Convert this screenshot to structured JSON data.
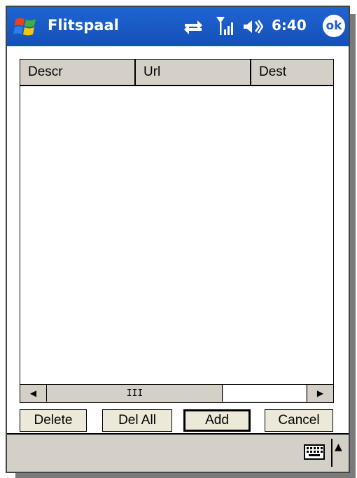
{
  "titlebar": {
    "app_title": "Flitspaal",
    "clock": "6:40",
    "ok_label": "ok",
    "start_icon": "windows-flag-icon",
    "network_icon": "data-connection-icon",
    "signal_icon": "signal-strength-icon",
    "speaker_icon": "speaker-icon"
  },
  "listview": {
    "columns": [
      "Descr",
      "Url",
      "Dest"
    ],
    "rows": [],
    "scroll_thumb_label": "III"
  },
  "buttons": {
    "delete": "Delete",
    "del_all": "Del All",
    "add": "Add",
    "cancel": "Cancel"
  },
  "menubar": {
    "keyboard_icon": "keyboard-icon",
    "sip_arrow": "▲"
  },
  "colors": {
    "titlebar": "#1f5fcf",
    "chrome": "#d4d0c8",
    "background": "#ffffff"
  }
}
